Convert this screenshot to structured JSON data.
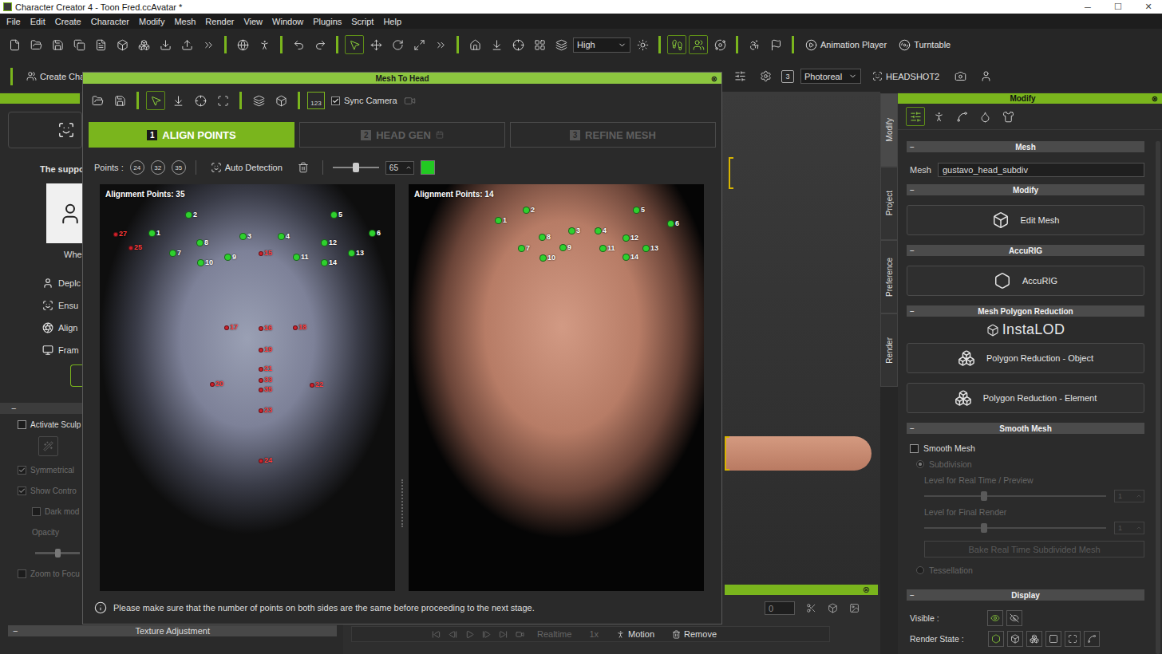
{
  "window": {
    "title": "Character Creator 4 - Toon Fred.ccAvatar *",
    "controls": [
      "─",
      "☐",
      "✕"
    ]
  },
  "menu": [
    "File",
    "Edit",
    "Create",
    "Character",
    "Modify",
    "Mesh",
    "Render",
    "View",
    "Window",
    "Plugins",
    "Script",
    "Help"
  ],
  "toolbar": {
    "quality": "High",
    "select_active": true,
    "gizmo_toggles": [
      true,
      true
    ],
    "animation_player": "Animation Player",
    "turntable": "Turntable"
  },
  "subbar": {
    "create_character": "Create Charact",
    "badge": "3",
    "render_mode": "Photoreal",
    "headshot": "HEADSHOT2"
  },
  "left_panel": {
    "support_text": "The suppor",
    "where_text": "Whe",
    "steps": [
      "Deplc",
      "Ensu",
      "Align",
      "Fram"
    ],
    "section_toggle": "−",
    "options": [
      {
        "kind": "checkbox",
        "label": "Activate Sculp",
        "checked": false,
        "disabled": false
      },
      {
        "kind": "checkbox",
        "label": "Symmetrical",
        "checked": true,
        "disabled": true
      },
      {
        "kind": "checkbox",
        "label": "Show Contro",
        "checked": true,
        "disabled": true
      },
      {
        "kind": "checkbox",
        "label": "Dark mod",
        "checked": false,
        "disabled": true
      },
      {
        "kind": "slider",
        "label": "Opacity",
        "level": 0.5,
        "disabled": true
      },
      {
        "kind": "checkbox",
        "label": "Zoom to Focu",
        "checked": false,
        "disabled": true
      }
    ],
    "texture_toggle": "−",
    "texture_section": "Texture Adjustment"
  },
  "dialog": {
    "title": "Mesh To Head",
    "close": "⊗",
    "toolbar_badge": "123",
    "sync_camera": {
      "label": "Sync Camera",
      "checked": true
    },
    "steps": [
      {
        "number": "1",
        "label": "ALIGN POINTS",
        "selected": true,
        "disabled": false
      },
      {
        "number": "2",
        "label": "HEAD GEN",
        "selected": false,
        "disabled": true
      },
      {
        "number": "3",
        "label": "REFINE MESH",
        "selected": false,
        "disabled": true
      }
    ],
    "points_label": "Points :",
    "point_presets": [
      "24",
      "32",
      "35"
    ],
    "auto_detection": "Auto Detection",
    "size": {
      "value": "65",
      "level": 0.5
    },
    "point_color": "#22c922",
    "panels": [
      {
        "caption": "Alignment Points: 35",
        "points": [
          {
            "label": "1",
            "color": "#2ed12e"
          },
          {
            "label": "2",
            "color": "#2ed12e"
          },
          {
            "label": "3",
            "color": "#2ed12e"
          },
          {
            "label": "4",
            "color": "#2ed12e"
          },
          {
            "label": "5",
            "color": "#2ed12e"
          },
          {
            "label": "6",
            "color": "#2ed12e"
          },
          {
            "label": "7",
            "color": "#2ed12e"
          },
          {
            "label": "8",
            "color": "#2ed12e"
          },
          {
            "label": "9",
            "color": "#2ed12e"
          },
          {
            "label": "10",
            "color": "#2ed12e"
          },
          {
            "label": "11",
            "color": "#2ed12e"
          },
          {
            "label": "12",
            "color": "#2ed12e"
          },
          {
            "label": "13",
            "color": "#2ed12e"
          },
          {
            "label": "14",
            "color": "#2ed12e"
          },
          {
            "label": "15",
            "color": "#d0202a"
          },
          {
            "label": "16",
            "color": "#d0202a"
          },
          {
            "label": "17",
            "color": "#d0202a"
          },
          {
            "label": "18",
            "color": "#d0202a"
          },
          {
            "label": "19",
            "color": "#d0202a"
          },
          {
            "label": "20",
            "color": "#d0202a"
          },
          {
            "label": "21",
            "color": "#d0202a"
          },
          {
            "label": "22",
            "color": "#d0202a"
          },
          {
            "label": "23",
            "color": "#d0202a"
          },
          {
            "label": "24",
            "color": "#d0202a"
          },
          {
            "label": "25",
            "color": "#d0202a"
          },
          {
            "label": "27",
            "color": "#d0202a"
          },
          {
            "label": "33",
            "color": "#d0202a"
          },
          {
            "label": "35",
            "color": "#d0202a"
          }
        ]
      },
      {
        "caption": "Alignment Points: 14",
        "points": [
          {
            "label": "1",
            "color": "#2ed12e"
          },
          {
            "label": "2",
            "color": "#2ed12e"
          },
          {
            "label": "3",
            "color": "#2ed12e"
          },
          {
            "label": "4",
            "color": "#2ed12e"
          },
          {
            "label": "5",
            "color": "#2ed12e"
          },
          {
            "label": "6",
            "color": "#2ed12e"
          },
          {
            "label": "7",
            "color": "#2ed12e"
          },
          {
            "label": "8",
            "color": "#2ed12e"
          },
          {
            "label": "9",
            "color": "#2ed12e"
          },
          {
            "label": "10",
            "color": "#2ed12e"
          },
          {
            "label": "11",
            "color": "#2ed12e"
          },
          {
            "label": "12",
            "color": "#2ed12e"
          },
          {
            "label": "13",
            "color": "#2ed12e"
          },
          {
            "label": "14",
            "color": "#2ed12e"
          }
        ]
      }
    ],
    "info": "Please make sure that the number of points on both sides are the same before proceeding to the next stage."
  },
  "viewport": {
    "dock_close": "⊗",
    "frame_value": "0"
  },
  "timeline": {
    "realtime": "Realtime",
    "speed": "1x",
    "motion": "Motion",
    "remove": "Remove"
  },
  "side_tabs": [
    {
      "label": "Modify",
      "selected": true
    },
    {
      "label": "Project",
      "selected": false
    },
    {
      "label": "Preference",
      "selected": false
    },
    {
      "label": "Render",
      "selected": false
    }
  ],
  "modify_panel": {
    "title": "Modify",
    "close": "⊗",
    "mesh_section": {
      "toggle": "−",
      "title": "Mesh",
      "field_label": "Mesh",
      "field_value": "gustavo_head_subdiv"
    },
    "modify_section": {
      "toggle": "−",
      "title": "Modify",
      "button": "Edit Mesh"
    },
    "accurig_section": {
      "toggle": "−",
      "title": "AccuRIG",
      "button": "AccuRIG"
    },
    "reduction_section": {
      "toggle": "−",
      "title": "Mesh Polygon Reduction",
      "logo": "InstaLOD",
      "buttons": [
        "Polygon Reduction - Object",
        "Polygon Reduction - Element"
      ]
    },
    "smooth_section": {
      "toggle": "−",
      "title": "Smooth Mesh",
      "smooth": {
        "label": "Smooth Mesh",
        "checked": false
      },
      "subdivision": {
        "label": "Subdivision",
        "selected": true,
        "disabled": true
      },
      "levels": [
        {
          "label": "Level for Real Time / Preview",
          "value": "1",
          "level": 0.33,
          "disabled": true
        },
        {
          "label": "Level for Final Render",
          "value": "1",
          "level": 0.33,
          "disabled": true
        }
      ],
      "bake": {
        "label": "Bake Real Time Subdivided Mesh",
        "disabled": true
      },
      "tessellation": {
        "label": "Tessellation",
        "selected": false,
        "disabled": true
      }
    },
    "display_section": {
      "toggle": "−",
      "title": "Display",
      "visible_label": "Visible :",
      "visible_modes": [
        true,
        false
      ],
      "render_state_label": "Render State :",
      "render_states": [
        true,
        false,
        false,
        false,
        false,
        false
      ]
    }
  }
}
